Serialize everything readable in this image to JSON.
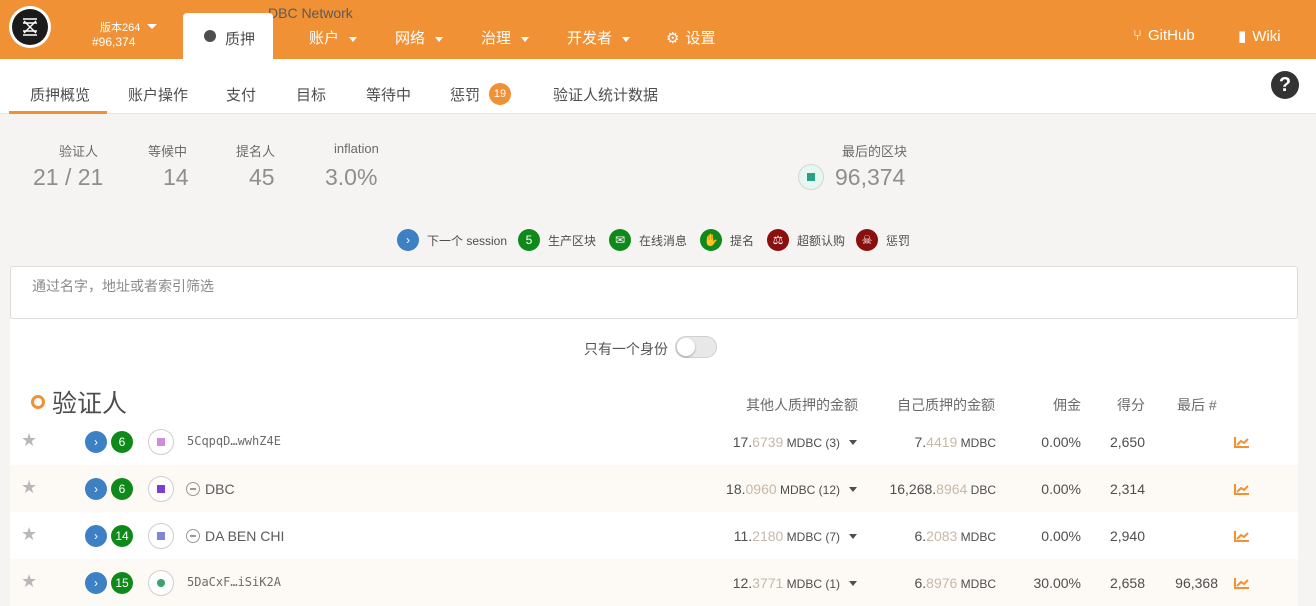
{
  "app": {
    "network_name": "DBC Network",
    "version": "版本264",
    "block": "#96,374"
  },
  "nav": {
    "active_tab": "质押",
    "menus": [
      "账户",
      "网络",
      "治理",
      "开发者"
    ],
    "settings": "设置",
    "github": "GitHub",
    "wiki": "Wiki"
  },
  "subnav": {
    "tabs": [
      "质押概览",
      "账户操作",
      "支付",
      "目标",
      "等待中",
      "惩罚",
      "验证人统计数据"
    ],
    "slash_count": "19"
  },
  "summary": {
    "validators_label": "验证人",
    "validators_value": "21 / 21",
    "waiting_label": "等候中",
    "waiting_value": "14",
    "nominators_label": "提名人",
    "nominators_value": "45",
    "inflation_label": "inflation",
    "inflation_value": "3.0%",
    "last_block_label": "最后的区块",
    "last_block_value": "96,374"
  },
  "legend": [
    {
      "icon": "chevron-right-icon",
      "symbol": "›",
      "label": "下一个 session",
      "color": "#3d80c4"
    },
    {
      "icon": "count-badge",
      "symbol": "5",
      "label": "生产区块",
      "color": "#0f8a1a"
    },
    {
      "icon": "envelope-icon",
      "symbol": "✉",
      "label": "在线消息",
      "color": "#0f8a1a"
    },
    {
      "icon": "hand-icon",
      "symbol": "✋",
      "label": "提名",
      "color": "#0f8a1a"
    },
    {
      "icon": "balance-scale-icon",
      "symbol": "⚖",
      "label": "超额认购",
      "color": "#8a0f0f"
    },
    {
      "icon": "skull-icon",
      "symbol": "☠",
      "label": "惩罚",
      "color": "#8a0f0f"
    }
  ],
  "filter": {
    "placeholder": "通过名字，地址或者索引筛选"
  },
  "toggle": {
    "label": "只有一个身份"
  },
  "table": {
    "title": "验证人",
    "headers": {
      "other_stake": "其他人质押的金额",
      "own_stake": "自己质押的金额",
      "commission": "佣金",
      "points": "得分",
      "last": "最后 #"
    },
    "rows": [
      {
        "name": "5CqpqD…wwhZ4E",
        "is_address": true,
        "blocks": "6",
        "other_int": "17.",
        "other_frac": "6739",
        "other_unit": " MDBC (3)",
        "own_int": "7.",
        "own_frac": "4419",
        "own_unit": " MDBC",
        "commission": "0.00%",
        "points": "2,650",
        "last": ""
      },
      {
        "name": "DBC",
        "is_address": false,
        "blocks": "6",
        "other_int": "18.",
        "other_frac": "0960",
        "other_unit": " MDBC (12)",
        "own_int": "16,268.",
        "own_frac": "8964",
        "own_unit": " DBC",
        "commission": "0.00%",
        "points": "2,314",
        "last": ""
      },
      {
        "name": "DA BEN CHI",
        "is_address": false,
        "blocks": "14",
        "other_int": "11.",
        "other_frac": "2180",
        "other_unit": " MDBC (7)",
        "own_int": "6.",
        "own_frac": "2083",
        "own_unit": " MDBC",
        "commission": "0.00%",
        "points": "2,940",
        "last": ""
      },
      {
        "name": "5DaCxF…iSiK2A",
        "is_address": true,
        "blocks": "15",
        "other_int": "12.",
        "other_frac": "3771",
        "other_unit": " MDBC (1)",
        "own_int": "6.",
        "own_frac": "8976",
        "own_unit": " MDBC",
        "commission": "30.00%",
        "points": "2,658",
        "last": "96,368"
      }
    ]
  },
  "colors": {
    "brand": "#f19135",
    "next_session": "#3d80c4",
    "good": "#0f8a1a",
    "bad": "#8a0f0f"
  }
}
